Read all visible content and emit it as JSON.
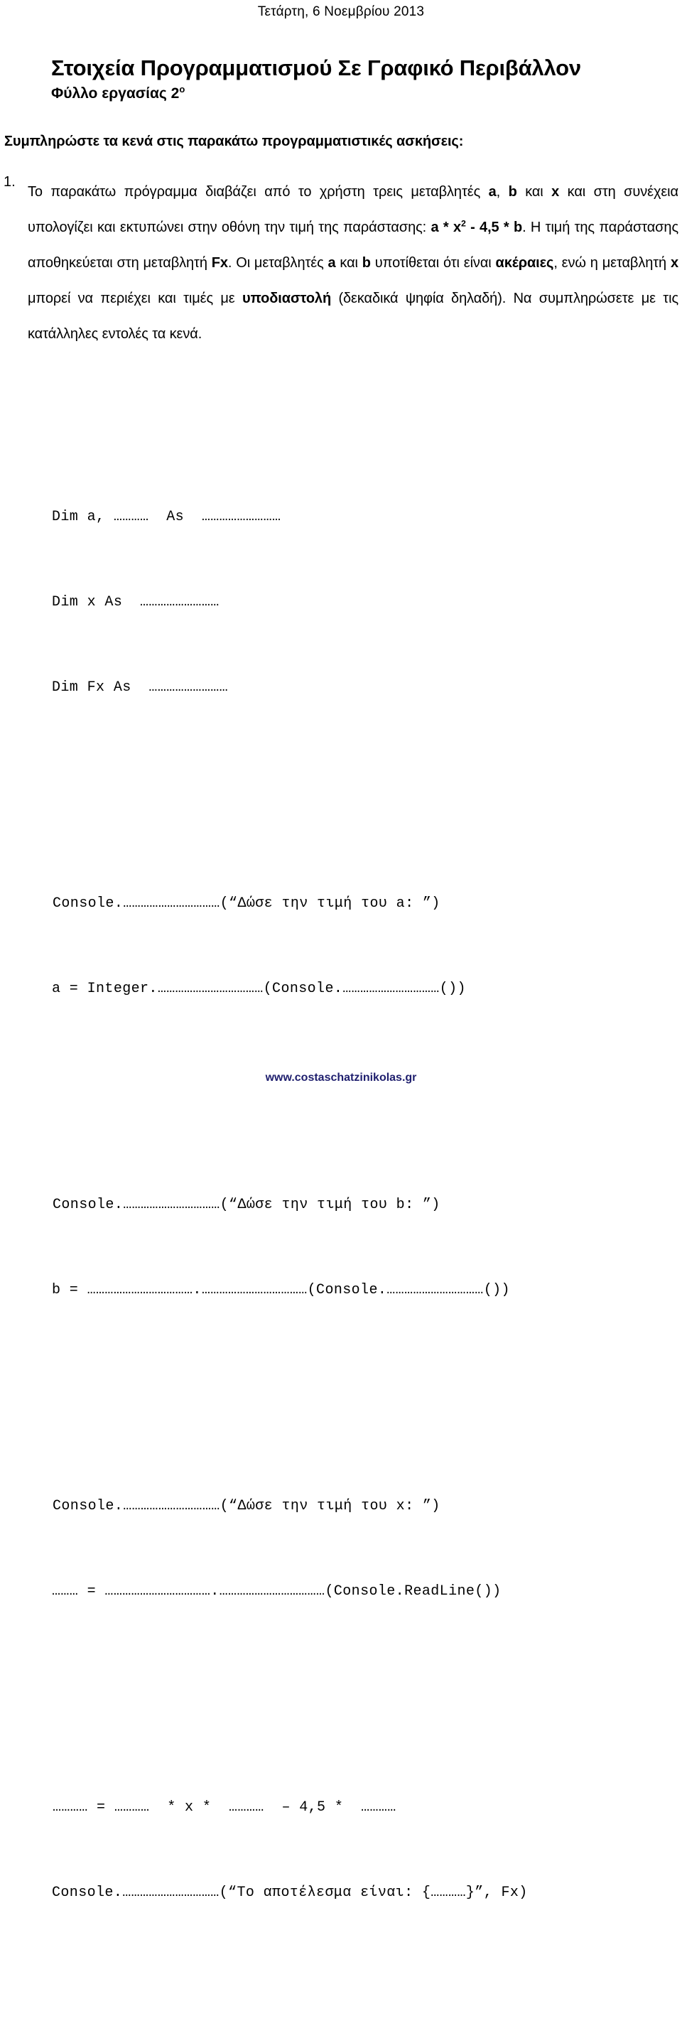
{
  "document": {
    "date_header": "Τετάρτη, 6 Νοεμβρίου 2013",
    "title": "Στοιχεία Προγραμματισμού Σε Γραφικό Περιβάλλον",
    "subtitle_text": "Φύλλο εργασίας 2",
    "subtitle_superscript": "ο",
    "instruction": "Συμπληρώστε τα κενά στις παρακάτω προγραμματιστικές ασκήσεις:",
    "footer_url": "www.costaschatzinikolas.gr",
    "footer_color": "#1f1f6e"
  },
  "exercise": {
    "number": "1.",
    "text_parts": {
      "p1": "Το παρακάτω πρόγραμμα διαβάζει από το χρήστη τρεις μεταβλητές ",
      "b1": "a",
      "p2": ", ",
      "b2": "b",
      "p3": " και ",
      "b3": "x",
      "p4": " και στη συνέχεια υπολογίζει και εκτυπώνει στην οθόνη την τιμή της παράστασης: ",
      "b4_a": "a * x",
      "b4_sup": "2",
      "b4_b": " - 4,5 * b",
      "p5": ". Η τιμή της παράστασης αποθηκεύεται στη μεταβλητή ",
      "b5": "Fx",
      "p6": ". Οι μεταβλητές ",
      "b6": "a",
      "p7": " και ",
      "b7": "b",
      "p8": " υποτίθεται ότι είναι ",
      "b8": "ακέραιες",
      "p9": ", ενώ η μεταβλητή ",
      "b9": "x",
      "p10": " μπορεί να περιέχει και τιμές με ",
      "b10": "υποδιαστολή",
      "p11": " (δεκαδικά ψηφία δηλαδή). Να συμπληρώσετε με τις κατάλληλες εντολές τα κενά."
    }
  },
  "code": {
    "groups": [
      {
        "lines": [
          "Dim a, …………  As  ………………………",
          "Dim x As  ………………………",
          "Dim Fx As  ………………………"
        ]
      },
      {
        "lines": [
          "Console.……………………………(“Δώσε την τιμή του a: ”)",
          "a = Integer.………………………………(Console.……………………………())"
        ]
      },
      {
        "lines": [
          "Console.……………………………(“Δώσε την τιμή του b: ”)",
          "b = ……………………………….………………………………(Console.……………………………())"
        ]
      },
      {
        "lines": [
          "Console.……………………………(“Δώσε την τιμή του x: ”)",
          "……… = ……………………………….………………………………(Console.ReadLine())"
        ]
      },
      {
        "lines": [
          "………… = …………  * x *  …………  – 4,5 *  …………",
          "Console.……………………………(“Το αποτέλεσμα είναι: {…………}”, Fx)"
        ]
      }
    ]
  }
}
